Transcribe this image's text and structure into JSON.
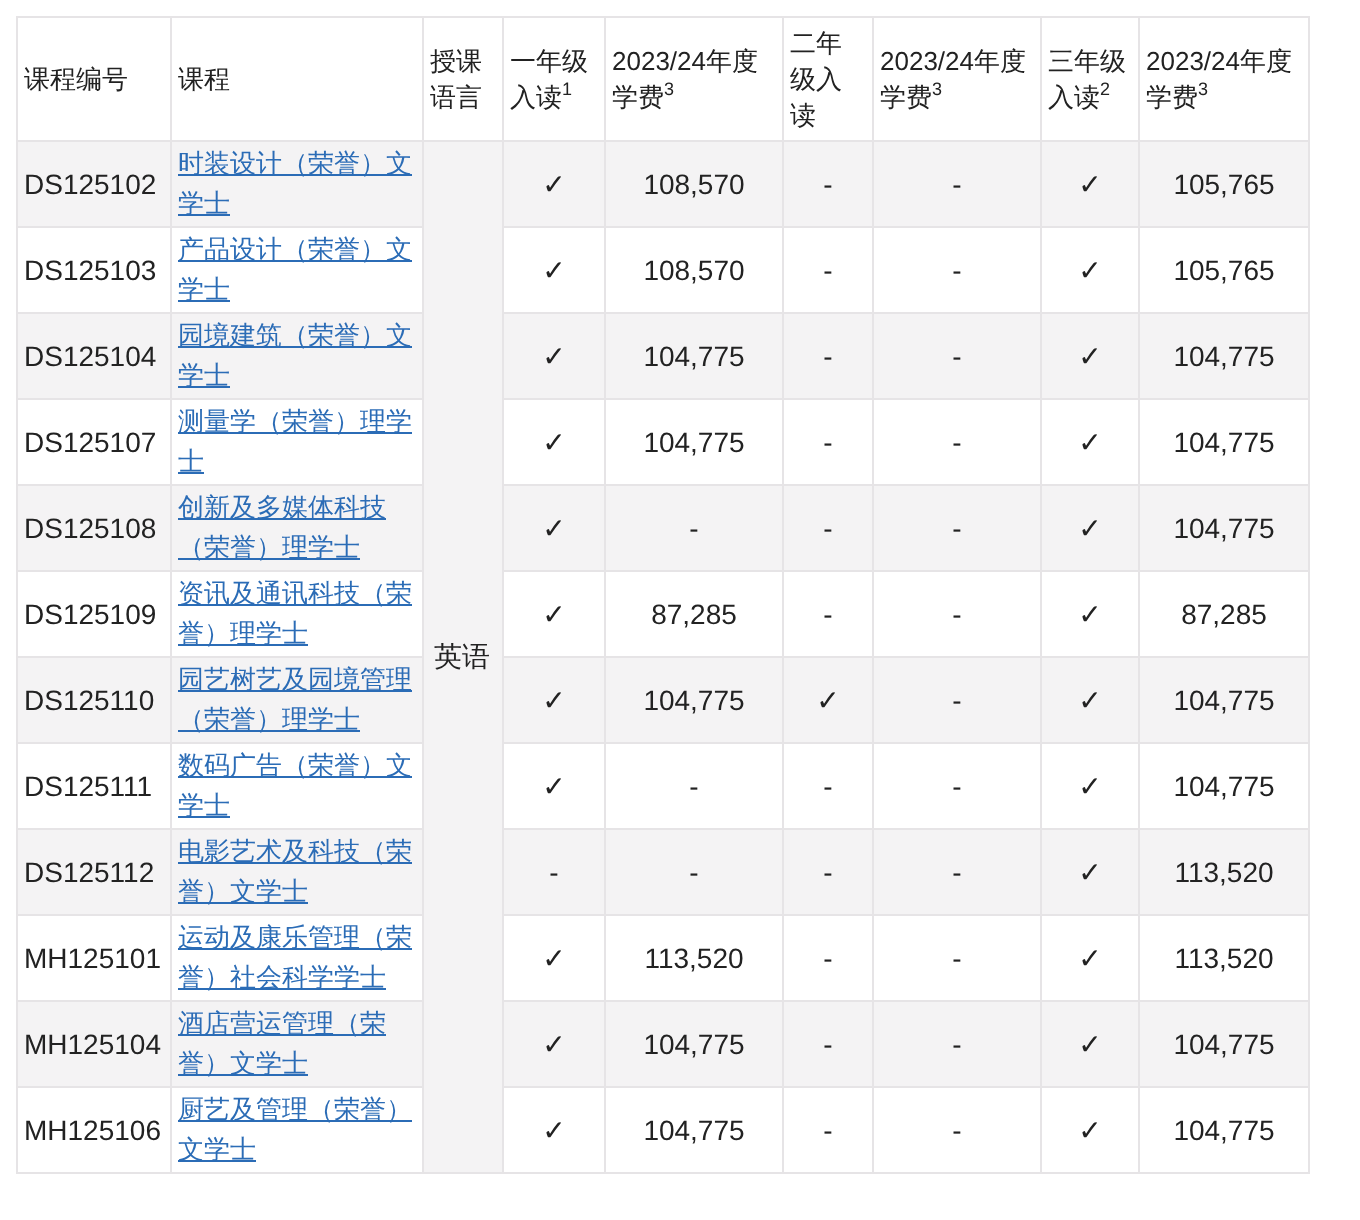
{
  "table": {
    "columns": [
      "课程编号",
      "课程",
      "授课语言",
      "一年级入读$^{1}$",
      "2023/24年度学费$^{3}$",
      "二年级入读",
      "2023/24年度学费$^{3}$",
      "三年级入读$^{2}$",
      "2023/24年度学费$^{3}$"
    ],
    "language": "英语",
    "rows": [
      {
        "code": "DS125102",
        "course": "时装设计（荣誉）文学士",
        "year1": "✓",
        "fee1": "108,570",
        "year2": "-",
        "fee2": "-",
        "year3": "✓",
        "fee3": "105,765"
      },
      {
        "code": "DS125103",
        "course": "产品设计（荣誉）文学士",
        "year1": "✓",
        "fee1": "108,570",
        "year2": "-",
        "fee2": "-",
        "year3": "✓",
        "fee3": "105,765"
      },
      {
        "code": "DS125104",
        "course": "园境建筑（荣誉）文学士",
        "year1": "✓",
        "fee1": "104,775",
        "year2": "-",
        "fee2": "-",
        "year3": "✓",
        "fee3": "104,775"
      },
      {
        "code": "DS125107",
        "course": "测量学（荣誉）理学士",
        "year1": "✓",
        "fee1": "104,775",
        "year2": "-",
        "fee2": "-",
        "year3": "✓",
        "fee3": "104,775"
      },
      {
        "code": "DS125108",
        "course": "创新及多媒体科技（荣誉）理学士",
        "year1": "✓",
        "fee1": "-",
        "year2": "-",
        "fee2": "-",
        "year3": "✓",
        "fee3": "104,775"
      },
      {
        "code": "DS125109",
        "course": "资讯及通讯科技（荣誉）理学士",
        "year1": "✓",
        "fee1": "87,285",
        "year2": "-",
        "fee2": "-",
        "year3": "✓",
        "fee3": "87,285"
      },
      {
        "code": "DS125110",
        "course": "园艺树艺及园境管理（荣誉）理学士",
        "year1": "✓",
        "fee1": "104,775",
        "year2": "✓",
        "fee2": "-",
        "year3": "✓",
        "fee3": "104,775"
      },
      {
        "code": "DS125111",
        "course": "数码广告（荣誉）文学士",
        "year1": "✓",
        "fee1": "-",
        "year2": "-",
        "fee2": "-",
        "year3": "✓",
        "fee3": "104,775"
      },
      {
        "code": "DS125112",
        "course": "电影艺术及科技（荣誉）文学士",
        "year1": "-",
        "fee1": "-",
        "year2": "-",
        "fee2": "-",
        "year3": "✓",
        "fee3": "113,520"
      },
      {
        "code": "MH125101",
        "course": "运动及康乐管理（荣誉）社会科学学士",
        "year1": "✓",
        "fee1": "113,520",
        "year2": "-",
        "fee2": "-",
        "year3": "✓",
        "fee3": "113,520"
      },
      {
        "code": "MH125104",
        "course": "酒店营运管理（荣誉）文学士",
        "year1": "✓",
        "fee1": "104,775",
        "year2": "-",
        "fee2": "-",
        "year3": "✓",
        "fee3": "104,775"
      },
      {
        "code": "MH125106",
        "course": "厨艺及管理（荣誉）文学士",
        "year1": "✓",
        "fee1": "104,775",
        "year2": "-",
        "fee2": "-",
        "year3": "✓",
        "fee3": "104,775"
      }
    ]
  }
}
